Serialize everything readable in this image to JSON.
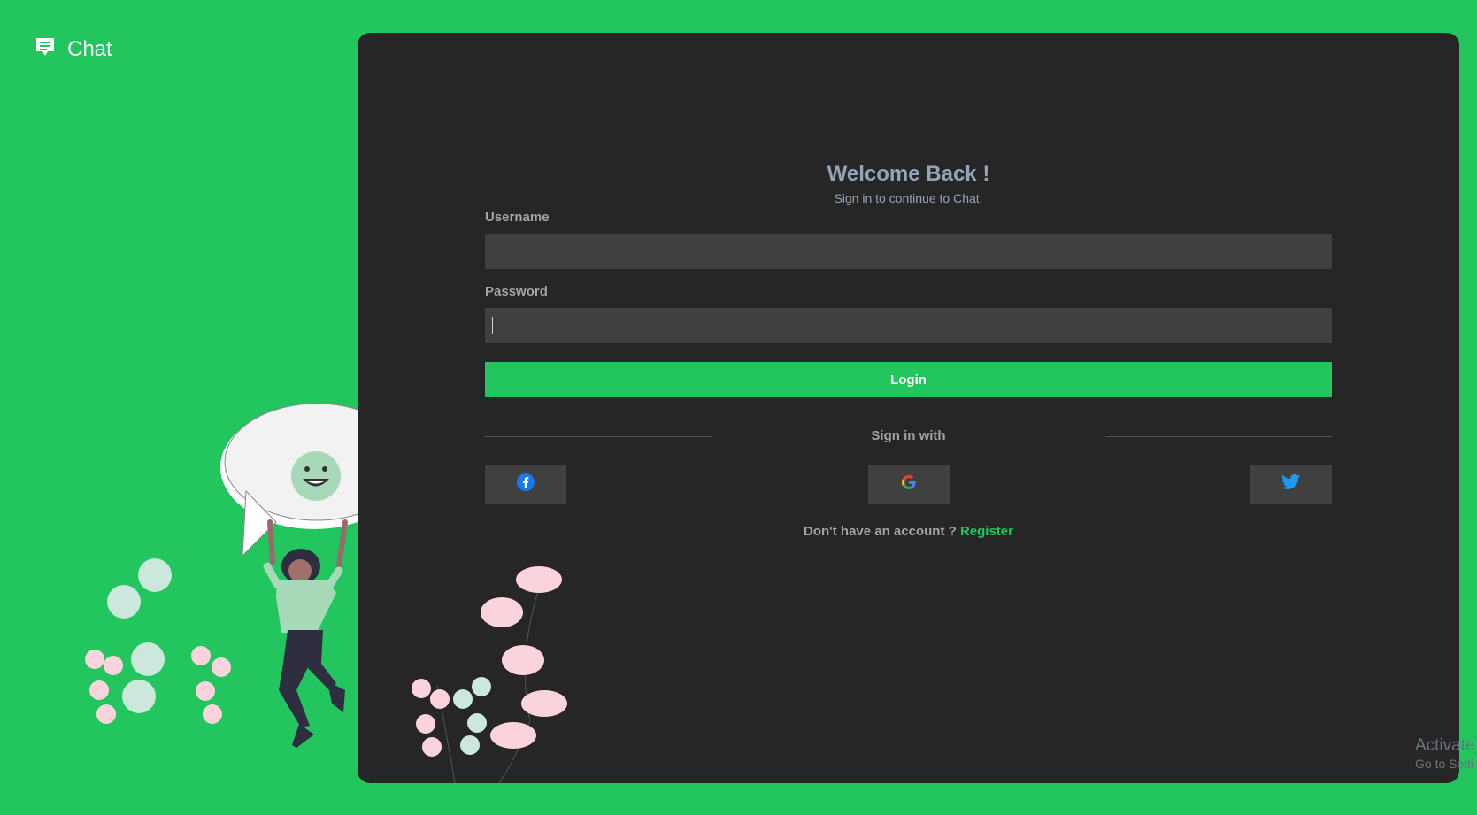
{
  "brand": {
    "name": "Chat",
    "icon": "chat-bubble-icon"
  },
  "login": {
    "title": "Welcome Back !",
    "subtitle": "Sign in to continue to Chat.",
    "username_label": "Username",
    "username_value": "",
    "password_label": "Password",
    "password_value": "",
    "submit_label": "Login",
    "divider_text": "Sign in with",
    "social": [
      {
        "name": "facebook",
        "icon": "facebook-icon",
        "color": "#1877f2"
      },
      {
        "name": "google",
        "icon": "google-icon",
        "color": "#ea4335"
      },
      {
        "name": "twitter",
        "icon": "twitter-icon",
        "color": "#1d9bf0"
      }
    ],
    "no_account_text": "Don't have an account ?",
    "register_label": "Register"
  },
  "watermark": {
    "line1": "Activate",
    "line2": "Go to Setti"
  },
  "colors": {
    "accent": "#22c55e",
    "panel": "#262626",
    "field": "#404040"
  }
}
